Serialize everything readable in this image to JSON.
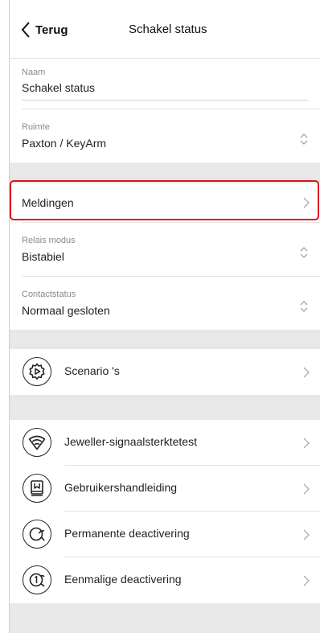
{
  "header": {
    "back_label": "Terug",
    "title": "Schakel status"
  },
  "fields": {
    "naam": {
      "label": "Naam",
      "value": "Schakel status"
    },
    "ruimte": {
      "label": "Ruimte",
      "value": "Paxton / KeyArm"
    },
    "meldingen": {
      "label": "Meldingen"
    },
    "relais": {
      "label": "Relais modus",
      "value": "Bistabiel"
    },
    "contact": {
      "label": "Contactstatus",
      "value": "Normaal gesloten"
    }
  },
  "rows": {
    "scenarios": {
      "label": "Scenario 's",
      "icon": "scenario-icon"
    },
    "jeweller": {
      "label": "Jeweller-signaalsterktetest",
      "icon": "wifi-signal-icon"
    },
    "handleiding": {
      "label": "Gebruikershandleiding",
      "icon": "book-icon"
    },
    "permanent": {
      "label": "Permanente deactivering",
      "icon": "permanent-deactivation-icon"
    },
    "eenmalig": {
      "label": "Eenmalige deactivering",
      "icon": "one-time-deactivation-icon"
    }
  },
  "colors": {
    "highlight": "#e0101c",
    "section_gap": "#e8e8e8"
  }
}
